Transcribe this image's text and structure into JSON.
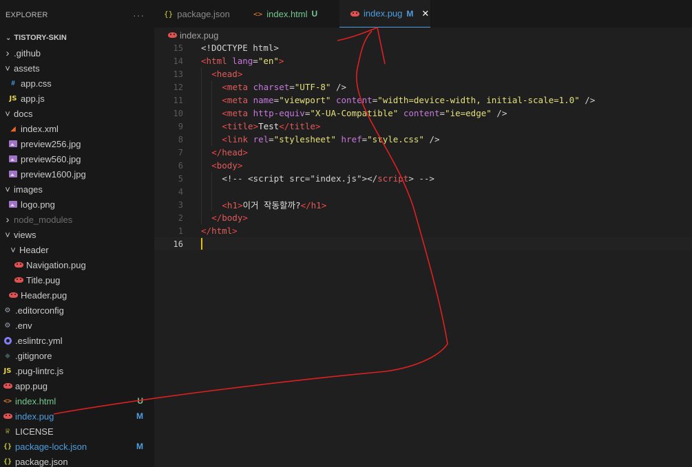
{
  "sidebar": {
    "title": "EXPLORER",
    "more": "···",
    "root": "TISTORY-SKIN",
    "items": [
      {
        "label": ".github",
        "type": "folder",
        "depth": 0,
        "open": false,
        "icon": "chevron-right-icon"
      },
      {
        "label": "assets",
        "type": "folder",
        "depth": 0,
        "open": true,
        "icon": "chevron-down-icon"
      },
      {
        "label": "app.css",
        "type": "file",
        "depth": 1,
        "icon": "css-icon",
        "glyph": "#"
      },
      {
        "label": "app.js",
        "type": "file",
        "depth": 1,
        "icon": "js-icon",
        "glyph": "JS"
      },
      {
        "label": "docs",
        "type": "folder",
        "depth": 0,
        "open": true,
        "icon": "chevron-down-icon"
      },
      {
        "label": "index.xml",
        "type": "file",
        "depth": 1,
        "icon": "rss-icon",
        "glyph": "☷"
      },
      {
        "label": "preview256.jpg",
        "type": "file",
        "depth": 1,
        "icon": "image-icon"
      },
      {
        "label": "preview560.jpg",
        "type": "file",
        "depth": 1,
        "icon": "image-icon"
      },
      {
        "label": "preview1600.jpg",
        "type": "file",
        "depth": 1,
        "icon": "image-icon"
      },
      {
        "label": "images",
        "type": "folder",
        "depth": 0,
        "open": true,
        "icon": "chevron-down-icon"
      },
      {
        "label": "logo.png",
        "type": "file",
        "depth": 1,
        "icon": "image-icon"
      },
      {
        "label": "node_modules",
        "type": "folder",
        "depth": 0,
        "open": false,
        "icon": "chevron-right-icon",
        "dim": true
      },
      {
        "label": "views",
        "type": "folder",
        "depth": 0,
        "open": true,
        "icon": "chevron-down-icon"
      },
      {
        "label": "Header",
        "type": "folder",
        "depth": 1,
        "open": true,
        "icon": "chevron-down-icon"
      },
      {
        "label": "Navigation.pug",
        "type": "file",
        "depth": 2,
        "icon": "pug-icon"
      },
      {
        "label": "Title.pug",
        "type": "file",
        "depth": 2,
        "icon": "pug-icon"
      },
      {
        "label": "Header.pug",
        "type": "file",
        "depth": 1,
        "icon": "pug-icon"
      },
      {
        "label": ".editorconfig",
        "type": "file",
        "depth": 0,
        "icon": "gear-icon",
        "glyph": "⚙"
      },
      {
        "label": ".env",
        "type": "file",
        "depth": 0,
        "icon": "gear-icon",
        "glyph": "⚙"
      },
      {
        "label": ".eslintrc.yml",
        "type": "file",
        "depth": 0,
        "icon": "eslint-icon"
      },
      {
        "label": ".gitignore",
        "type": "file",
        "depth": 0,
        "icon": "git-icon",
        "glyph": "◆"
      },
      {
        "label": ".pug-lintrc.js",
        "type": "file",
        "depth": 0,
        "icon": "js-icon",
        "glyph": "JS"
      },
      {
        "label": "app.pug",
        "type": "file",
        "depth": 0,
        "icon": "pug-icon"
      },
      {
        "label": "index.html",
        "type": "file",
        "depth": 0,
        "icon": "html-icon",
        "glyph": "<>",
        "status": "U"
      },
      {
        "label": "index.pug",
        "type": "file",
        "depth": 0,
        "icon": "pug-icon",
        "status": "M"
      },
      {
        "label": "LICENSE",
        "type": "file",
        "depth": 0,
        "icon": "license-icon",
        "glyph": "♕"
      },
      {
        "label": "package-lock.json",
        "type": "file",
        "depth": 0,
        "icon": "json-icon",
        "glyph": "{}",
        "status": "M"
      },
      {
        "label": "package.json",
        "type": "file",
        "depth": 0,
        "icon": "json-icon",
        "glyph": "{}"
      }
    ]
  },
  "tabs": [
    {
      "label": "package.json",
      "glyph": "{}",
      "icon": "json-icon",
      "status": ""
    },
    {
      "label": "index.html",
      "glyph": "<>",
      "icon": "html-icon",
      "status": "U"
    },
    {
      "label": "index.pug",
      "icon": "pug-icon",
      "status": "M",
      "active": true,
      "close": "✕"
    }
  ],
  "breadcrumb": {
    "label": "index.pug"
  },
  "editor": {
    "lines": [
      {
        "num": "15",
        "indent": 0,
        "tokens": [
          [
            "pun",
            "<!DOCTYPE html>"
          ]
        ]
      },
      {
        "num": "14",
        "indent": 0,
        "tokens": [
          [
            "tag",
            "<"
          ],
          [
            "tagname",
            "html"
          ],
          [
            "pun",
            " "
          ],
          [
            "attr",
            "lang"
          ],
          [
            "pun",
            "="
          ],
          [
            "str",
            "\"en\""
          ],
          [
            "tag",
            ">"
          ]
        ]
      },
      {
        "num": "13",
        "indent": 1,
        "tokens": [
          [
            "tag",
            "<"
          ],
          [
            "tagname",
            "head"
          ],
          [
            "tag",
            ">"
          ]
        ]
      },
      {
        "num": "12",
        "indent": 2,
        "tokens": [
          [
            "tag",
            "<"
          ],
          [
            "tagname",
            "meta"
          ],
          [
            "pun",
            " "
          ],
          [
            "attr",
            "charset"
          ],
          [
            "pun",
            "="
          ],
          [
            "str",
            "\"UTF-8\""
          ],
          [
            "pun",
            " />"
          ]
        ]
      },
      {
        "num": "11",
        "indent": 2,
        "tokens": [
          [
            "tag",
            "<"
          ],
          [
            "tagname",
            "meta"
          ],
          [
            "pun",
            " "
          ],
          [
            "attr",
            "name"
          ],
          [
            "pun",
            "="
          ],
          [
            "str",
            "\"viewport\""
          ],
          [
            "pun",
            " "
          ],
          [
            "attr",
            "content"
          ],
          [
            "pun",
            "="
          ],
          [
            "str",
            "\"width=device-width, initial-scale=1.0\""
          ],
          [
            "pun",
            " />"
          ]
        ]
      },
      {
        "num": "10",
        "indent": 2,
        "tokens": [
          [
            "tag",
            "<"
          ],
          [
            "tagname",
            "meta"
          ],
          [
            "pun",
            " "
          ],
          [
            "attr",
            "http-equiv"
          ],
          [
            "pun",
            "="
          ],
          [
            "str",
            "\"X-UA-Compatible\""
          ],
          [
            "pun",
            " "
          ],
          [
            "attr",
            "content"
          ],
          [
            "pun",
            "="
          ],
          [
            "str",
            "\"ie=edge\""
          ],
          [
            "pun",
            " />"
          ]
        ]
      },
      {
        "num": "9",
        "indent": 2,
        "tokens": [
          [
            "tag",
            "<"
          ],
          [
            "tagname",
            "title"
          ],
          [
            "tag",
            ">"
          ],
          [
            "txt",
            "Test"
          ],
          [
            "tag",
            "</"
          ],
          [
            "tagname",
            "title"
          ],
          [
            "tag",
            ">"
          ]
        ]
      },
      {
        "num": "8",
        "indent": 2,
        "tokens": [
          [
            "tag",
            "<"
          ],
          [
            "tagname",
            "link"
          ],
          [
            "pun",
            " "
          ],
          [
            "attr",
            "rel"
          ],
          [
            "pun",
            "="
          ],
          [
            "str",
            "\"stylesheet\""
          ],
          [
            "pun",
            " "
          ],
          [
            "attr",
            "href"
          ],
          [
            "pun",
            "="
          ],
          [
            "str",
            "\"style.css\""
          ],
          [
            "pun",
            " />"
          ]
        ]
      },
      {
        "num": "7",
        "indent": 1,
        "tokens": [
          [
            "tag",
            "</"
          ],
          [
            "tagname",
            "head"
          ],
          [
            "tag",
            ">"
          ]
        ]
      },
      {
        "num": "6",
        "indent": 1,
        "tokens": [
          [
            "tag",
            "<"
          ],
          [
            "tagname",
            "body"
          ],
          [
            "tag",
            ">"
          ]
        ]
      },
      {
        "num": "5",
        "indent": 2,
        "tokens": [
          [
            "cmt",
            "<!-- <script src=\"index.js\"></"
          ],
          [
            "tagname",
            "script"
          ],
          [
            "cmt",
            "> -->"
          ]
        ]
      },
      {
        "num": "4",
        "indent": 2,
        "tokens": []
      },
      {
        "num": "3",
        "indent": 2,
        "tokens": [
          [
            "tag",
            "<"
          ],
          [
            "tagname",
            "h1"
          ],
          [
            "tag",
            ">"
          ],
          [
            "txt",
            "이거 작동할까?"
          ],
          [
            "tag",
            "</"
          ],
          [
            "tagname",
            "h1"
          ],
          [
            "tag",
            ">"
          ]
        ]
      },
      {
        "num": "2",
        "indent": 1,
        "tokens": [
          [
            "tag",
            "</"
          ],
          [
            "tagname",
            "body"
          ],
          [
            "tag",
            ">"
          ]
        ]
      },
      {
        "num": "1",
        "indent": 0,
        "tokens": [
          [
            "tag",
            "</"
          ],
          [
            "tagname",
            "html"
          ],
          [
            "tag",
            ">"
          ]
        ]
      },
      {
        "num": "16",
        "indent": 0,
        "tokens": [],
        "current": true
      }
    ]
  },
  "colors": {
    "accent": "#4f9ee0",
    "untracked": "#73c991",
    "modified": "#e2c08d",
    "annotation": "#e02020"
  }
}
